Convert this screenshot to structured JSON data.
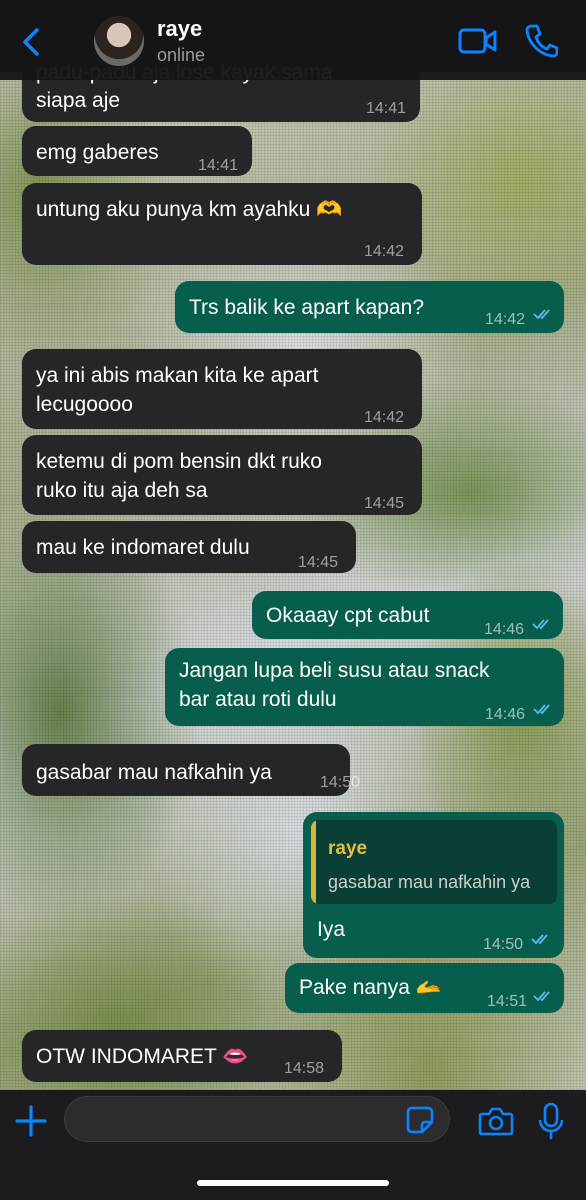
{
  "header": {
    "contact_name": "raye",
    "status": "online"
  },
  "messages": [
    {
      "dir": "in",
      "lines": [
        "padu-padu aja lose kayak sama",
        "siapa aje"
      ],
      "time": "14:41"
    },
    {
      "dir": "in",
      "lines": [
        "emg gaberes"
      ],
      "time": "14:41"
    },
    {
      "dir": "in",
      "lines": [
        "untung aku punya km ayahku 🫶"
      ],
      "time": "14:42"
    },
    {
      "dir": "out",
      "lines": [
        "Trs balik ke apart kapan?"
      ],
      "time": "14:42",
      "read": true
    },
    {
      "dir": "in",
      "lines": [
        "ya ini abis makan kita ke apart",
        "lecugoooo"
      ],
      "time": "14:42"
    },
    {
      "dir": "in",
      "lines": [
        "ketemu di pom bensin dkt ruko",
        "ruko itu aja deh sa"
      ],
      "time": "14:45"
    },
    {
      "dir": "in",
      "lines": [
        "mau ke indomaret dulu"
      ],
      "time": "14:45"
    },
    {
      "dir": "out",
      "lines": [
        "Okaaay cpt cabut"
      ],
      "time": "14:46",
      "read": true
    },
    {
      "dir": "out",
      "lines": [
        "Jangan lupa beli susu atau snack",
        "bar atau roti dulu"
      ],
      "time": "14:46",
      "read": true
    },
    {
      "dir": "in",
      "lines": [
        "gasabar mau nafkahin ya"
      ],
      "time": "14:50"
    },
    {
      "dir": "out",
      "lines": [
        "Iya"
      ],
      "time": "14:50",
      "read": true,
      "reply_to": {
        "name": "raye",
        "text": "gasabar mau nafkahin ya"
      }
    },
    {
      "dir": "out",
      "lines": [
        "Pake nanya 🫴"
      ],
      "time": "14:51",
      "read": true
    },
    {
      "dir": "in",
      "lines": [
        "OTW INDOMARET 👄"
      ],
      "time": "14:58"
    }
  ],
  "composer": {
    "value": "",
    "placeholder": ""
  },
  "colors": {
    "accent": "#0a84ff",
    "incoming_bubble": "#262628",
    "outgoing_bubble": "#075e4d",
    "reply_name": "#e3bf3f",
    "read_ticks": "#53bdeb"
  },
  "icons": [
    "back-icon",
    "video-call-icon",
    "phone-icon",
    "plus-icon",
    "sticker-icon",
    "camera-icon",
    "microphone-icon",
    "read-ticks-icon"
  ]
}
